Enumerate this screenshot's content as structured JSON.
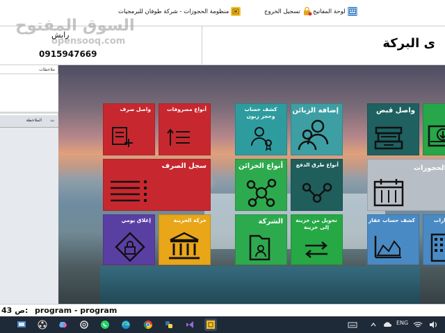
{
  "menu": {
    "keyboard_label": "لوحة المفاتيح",
    "logout_label": "تسجيل الخروج",
    "system_label": "منظومة الحجوزات - شركة طوفان للبرمجيات"
  },
  "header": {
    "company_name": "ى البركة",
    "person_name": "رابش",
    "phone": "0915947669",
    "watermark_ar": "السوق المفتوح",
    "watermark_en": "opensooq.com"
  },
  "left_panel": {
    "notes_label": "ملاحظات",
    "grid_headers": [
      "ت",
      "الملاحظة"
    ]
  },
  "tiles": [
    {
      "id": "expense-receipt",
      "label": "واصل صرف",
      "color": "red"
    },
    {
      "id": "expense-types",
      "label": "أنواع مصروفات",
      "color": "red"
    },
    {
      "id": "customer-account-statement",
      "label": "كشف حساب وحجز زبون",
      "color": "teal"
    },
    {
      "id": "add-customers",
      "label": "إضافة الزبائن",
      "color": "teal"
    },
    {
      "id": "receipt-voucher",
      "label": "واصل قبض",
      "color": "darkteal"
    },
    {
      "id": "expense-register",
      "label": "سجل الصرف",
      "color": "red"
    },
    {
      "id": "treasury-types",
      "label": "أنواع الخزائن",
      "color": "green"
    },
    {
      "id": "payment-methods",
      "label": "أنواع طرق الدفع",
      "color": "darkteal"
    },
    {
      "id": "reservations",
      "label": "الحجوزات",
      "color": "gray"
    },
    {
      "id": "daily-close",
      "label": "إغلاق يومي",
      "color": "purple"
    },
    {
      "id": "treasury-movement",
      "label": "حركة الخزينة",
      "color": "yellow"
    },
    {
      "id": "company",
      "label": "الشركة",
      "color": "green"
    },
    {
      "id": "treasury-transfer",
      "label": "تحويل من خزينة إلى خزينة",
      "color": "green"
    },
    {
      "id": "property-account-statement",
      "label": "كشف حساب عقار",
      "color": "blue"
    },
    {
      "id": "properties",
      "label": "قارات",
      "color": "blue"
    }
  ],
  "status": {
    "time": "ص 43:",
    "program": "program - program"
  },
  "taskbar": {
    "tray_lang": "ENG"
  },
  "colors": {
    "red": "#c7282f",
    "teal": "#2e9c9e",
    "green": "#2eaa4e",
    "darkteal": "#1e6160",
    "gray": "#b8bec5",
    "blue": "#4a8ac4",
    "purple": "#5a3fa3",
    "yellow": "#e8a618"
  }
}
